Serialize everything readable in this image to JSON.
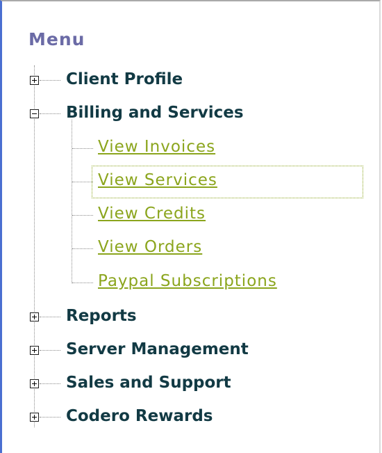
{
  "menu": {
    "title": "Menu",
    "items": [
      {
        "label": "Client Profile",
        "state": "collapsed"
      },
      {
        "label": "Billing and Services",
        "state": "expanded",
        "children": [
          {
            "label": "View Invoices"
          },
          {
            "label": "View Services",
            "focused": true
          },
          {
            "label": "View Credits"
          },
          {
            "label": "View Orders"
          },
          {
            "label": "Paypal Subscriptions"
          }
        ]
      },
      {
        "label": "Reports",
        "state": "collapsed"
      },
      {
        "label": "Server Management",
        "state": "collapsed"
      },
      {
        "label": "Sales and Support",
        "state": "collapsed"
      },
      {
        "label": "Codero Rewards",
        "state": "collapsed"
      }
    ]
  },
  "colors": {
    "title": "#6b6ba6",
    "node_label": "#123a44",
    "link": "#8ba51d",
    "left_border": "#4a6fd1"
  },
  "icons": {
    "expand": "plus-box-icon",
    "collapse": "minus-box-icon"
  }
}
